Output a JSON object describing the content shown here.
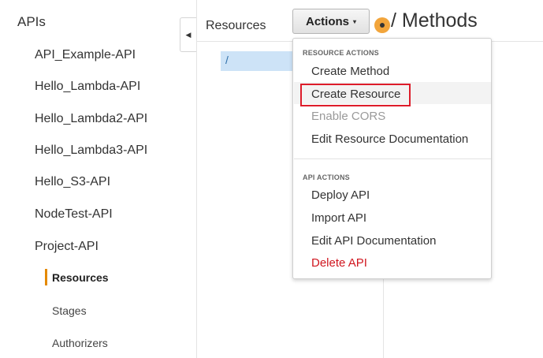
{
  "sidebar": {
    "title": "APIs",
    "apis": [
      "API_Example-API",
      "Hello_Lambda-API",
      "Hello_Lambda2-API",
      "Hello_Lambda3-API",
      "Hello_S3-API",
      "NodeTest-API",
      "Project-API"
    ],
    "sub_items": [
      "Resources",
      "Stages",
      "Authorizers"
    ],
    "active_sub_item": "Resources",
    "accent_color": "#e48a00"
  },
  "collapse_tab": {
    "icon": "chevron-left-icon",
    "glyph": "◀"
  },
  "resources_panel": {
    "header": "Resources",
    "selected_path": "/"
  },
  "actions_button": {
    "label": "Actions",
    "caret": "▾"
  },
  "methods": {
    "title": "/ Methods"
  },
  "dropdown": {
    "resource_actions_header": "RESOURCE ACTIONS",
    "create_method": "Create Method",
    "create_resource": "Create Resource",
    "enable_cors": "Enable CORS",
    "edit_resource_documentation": "Edit Resource Documentation",
    "api_actions_header": "API ACTIONS",
    "deploy_api": "Deploy API",
    "import_api": "Import API",
    "edit_api_documentation": "Edit API Documentation",
    "delete_api": "Delete API",
    "danger_color": "#d0161f",
    "highlight_color": "#dd1c2a"
  }
}
